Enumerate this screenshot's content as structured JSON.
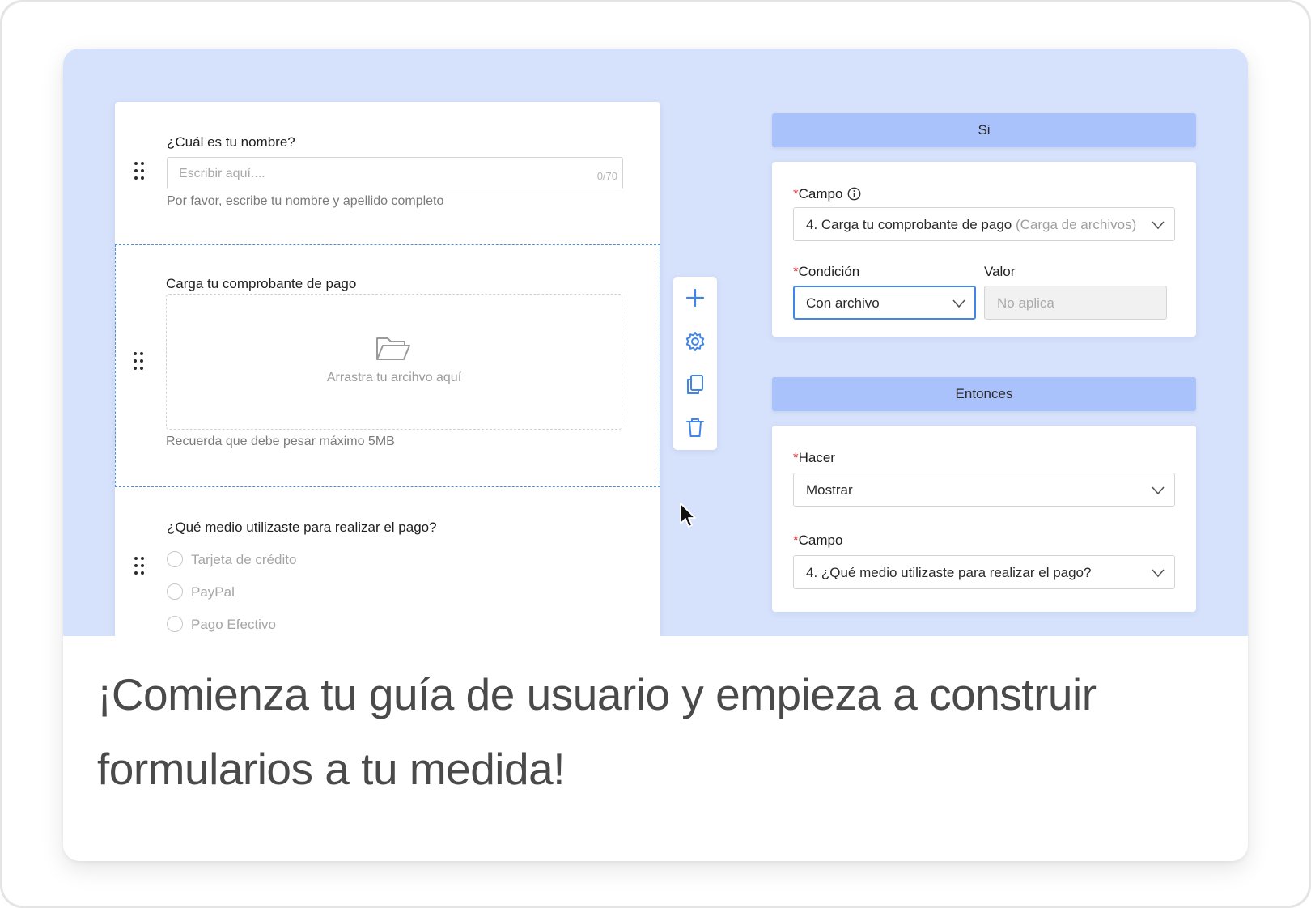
{
  "form": {
    "question1": {
      "label": "¿Cuál es tu nombre?",
      "placeholder": "Escribir aquí....",
      "counter": "0/70",
      "help": "Por favor, escribe tu nombre y apellido completo"
    },
    "question2": {
      "label": "Carga tu comprobante de pago",
      "dropzone_text": "Arrastra tu arcihvo aquí",
      "help": "Recuerda que debe pesar máximo 5MB"
    },
    "question3": {
      "label": "¿Qué medio utilizaste para realizar el pago?",
      "options": [
        "Tarjeta de crédito",
        "PayPal",
        "Pago Efectivo"
      ]
    }
  },
  "toolbar": {
    "icons": [
      "plus-icon",
      "gear-icon",
      "copy-icon",
      "trash-icon"
    ]
  },
  "rules": {
    "if_header": "Si",
    "if": {
      "field_label": "Campo",
      "field_value": "4. Carga tu comprobante de pago",
      "field_type": "(Carga de archivos)",
      "condition_label": "Condición",
      "condition_value": "Con archivo",
      "value_label": "Valor",
      "value_value": "No aplica"
    },
    "then_header": "Entonces",
    "then": {
      "action_label": "Hacer",
      "action_value": "Mostrar",
      "field_label": "Campo",
      "field_value": "4. ¿Qué medio utilizaste para realizar el pago?"
    },
    "required_mark": "*"
  },
  "caption": "¡Comienza tu guía de usuario y empieza a construir formularios a tu medida!",
  "colors": {
    "illustration_bg": "#d6e2fc",
    "band": "#a9c2fb",
    "accent": "#3f86e8",
    "required": "#e0313b"
  }
}
